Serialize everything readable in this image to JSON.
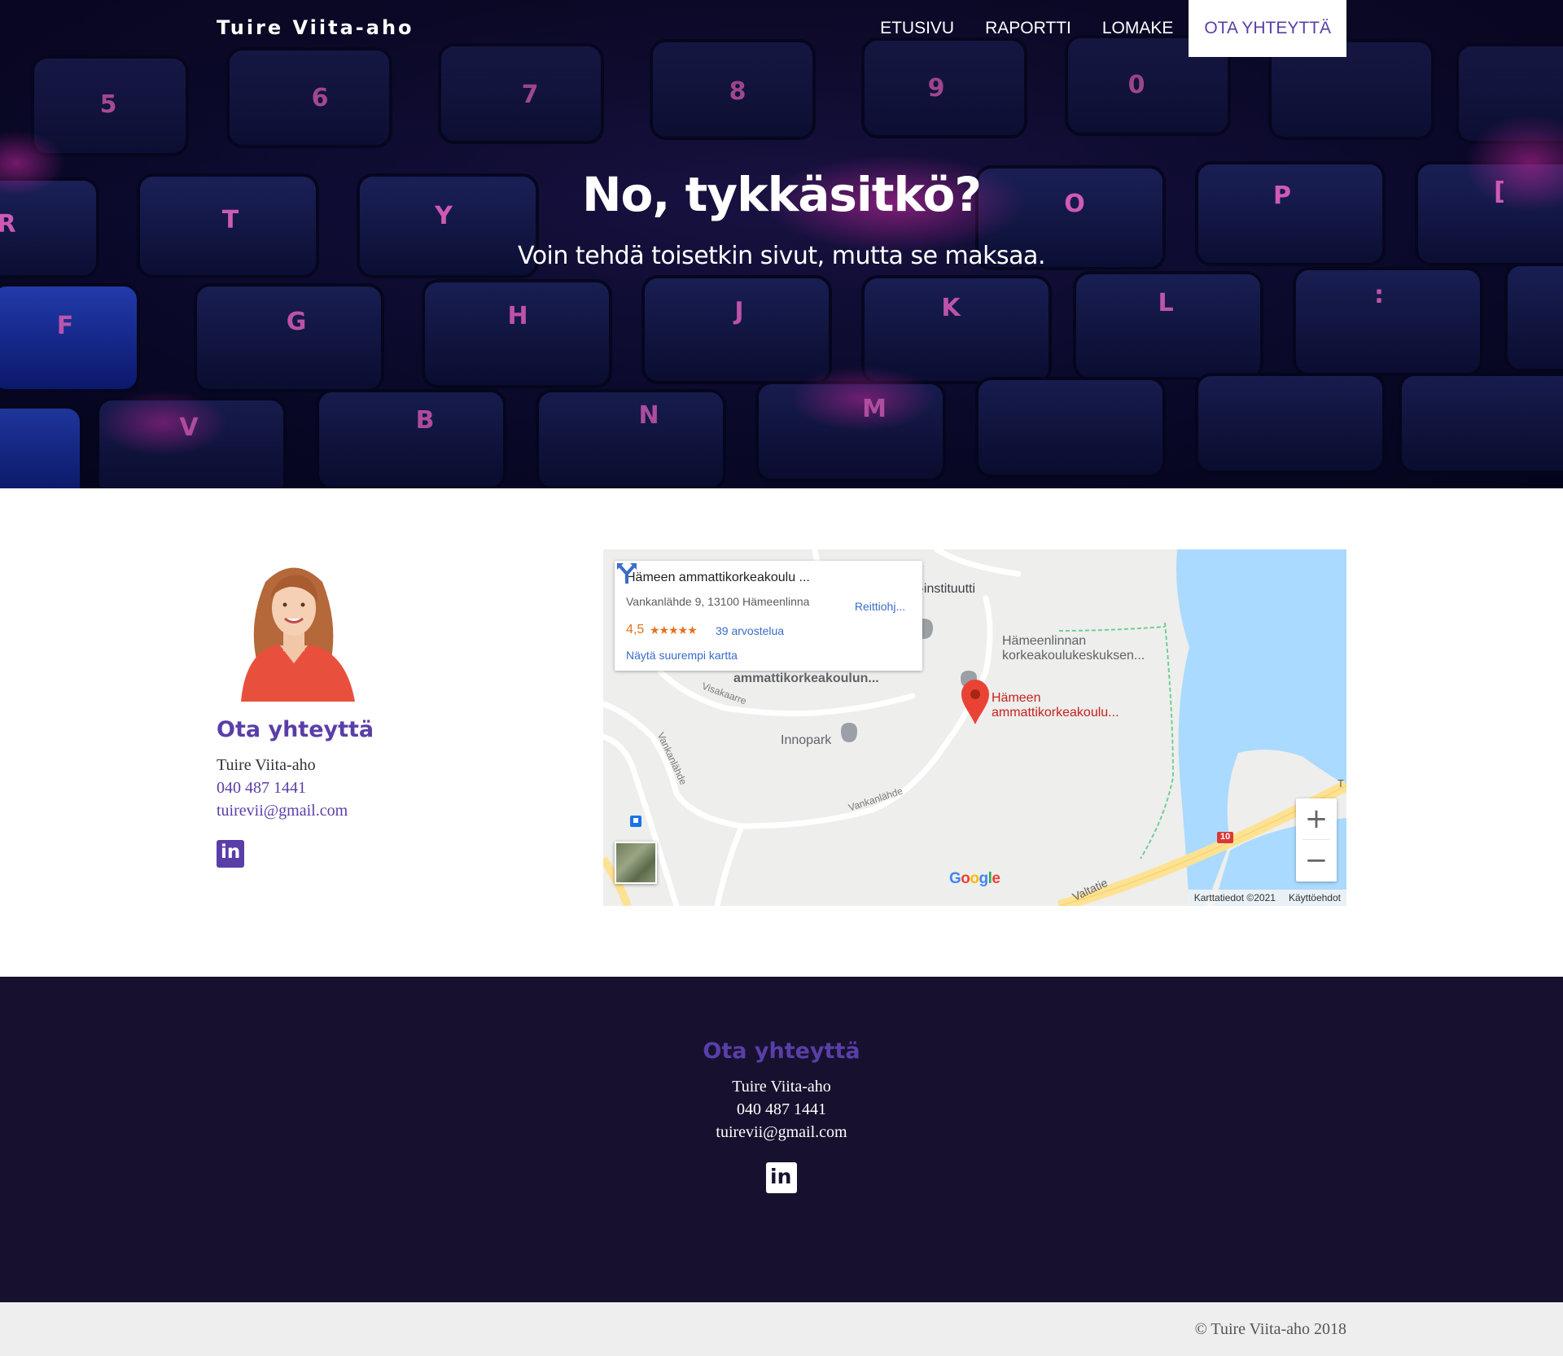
{
  "brand": "Tuire Viita-aho",
  "nav": {
    "items": [
      {
        "label": "ETUSIVU"
      },
      {
        "label": "RAPORTTI"
      },
      {
        "label": "LOMAKE"
      },
      {
        "label": "OTA YHTEYTTÄ",
        "active": true
      }
    ]
  },
  "hero": {
    "title": "No, tykkäsitkö?",
    "subtitle": "Voin tehdä toisetkin sivut, mutta se maksaa."
  },
  "contact": {
    "title": "Ota yhteyttä",
    "name": "Tuire Viita-aho",
    "phone": "040 487 1441",
    "email": "tuirevii@gmail.com",
    "social_icon": "linkedin-icon"
  },
  "map": {
    "card": {
      "title": "Hämeen ammattikorkeakoulu ...",
      "address": "Vankanlähde 9, 13100 Hämeenlinna",
      "rating": "4,5",
      "stars": "★★★★★",
      "reviews": "39 arvostelua",
      "bigger_map": "Näytä suurempi kartta",
      "directions": "Reittiohj..."
    },
    "labels": {
      "institute": "i-instituutti",
      "lukio_line1": "Hämeenlinnan",
      "lukio_line2": "korkeakoulukeskuksen...",
      "hamk_line1": "Hämeen",
      "hamk_line2": "ammattikorkeakoulu...",
      "amk_building": "ammattikorkeakoulun...",
      "innopark": "Innopark",
      "visakaarre": "Visakaarre",
      "vankanlahde_1": "Vankanlähde",
      "vankanlahde_2": "Vankanlähde",
      "valtatie": "Valtatie",
      "road_number": "10",
      "road_t": "T"
    },
    "zoom_in": "+",
    "zoom_out": "−",
    "google": [
      "G",
      "o",
      "o",
      "g",
      "l",
      "e"
    ],
    "google_colors": [
      "#4285F4",
      "#EA4335",
      "#FBBC05",
      "#4285F4",
      "#34A853",
      "#EA4335"
    ],
    "attribution": {
      "data": "Karttatiedot ©2021",
      "terms": "Käyttöehdot"
    }
  },
  "footer": {
    "title": "Ota yhteyttä",
    "name": "Tuire Viita-aho",
    "phone": "040 487 1441",
    "email": "tuirevii@gmail.com",
    "copyright": "© Tuire Viita-aho 2018"
  },
  "colors": {
    "accent": "#5a3ea8",
    "footer_bg": "#17112f",
    "water": "#aadaff"
  },
  "keyboard_letters": [
    "5",
    "6",
    "7",
    "8",
    "9",
    "0",
    "R",
    "T",
    "Y",
    "O",
    "P",
    "[",
    "F",
    "G",
    "H",
    "J",
    "K",
    "L",
    ":",
    "V",
    "B",
    "N",
    "M"
  ]
}
